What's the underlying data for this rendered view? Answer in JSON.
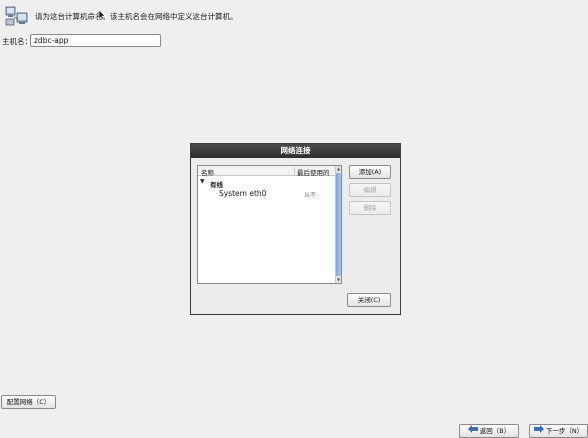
{
  "header": {
    "instruction": "请为这台计算机命名。该主机名会在网络中定义这台计算机。",
    "icon": "network-computer-icon"
  },
  "hostname": {
    "label": "主机名：",
    "value": "zdbc-app"
  },
  "dialog": {
    "title": "网络连接",
    "columns": {
      "name": "名称",
      "last_used": "最后使用的"
    },
    "group": {
      "label": "有线"
    },
    "connections": [
      {
        "name": "System eth0",
        "last_used": "从不"
      }
    ],
    "buttons": {
      "add": "添加(A)",
      "edit": "编辑",
      "delete": "删除",
      "close": "关闭(C)"
    }
  },
  "footer": {
    "configure_network": "配置网络（C）",
    "back": "返回（B）",
    "next": "下一步（N）"
  },
  "colors": {
    "background": "#efefef",
    "titlebar": "#3a3a3a",
    "scroll_thumb": "#8fb6e2",
    "back_arrow": "#3b6fb6",
    "next_arrow": "#3b6fb6"
  }
}
